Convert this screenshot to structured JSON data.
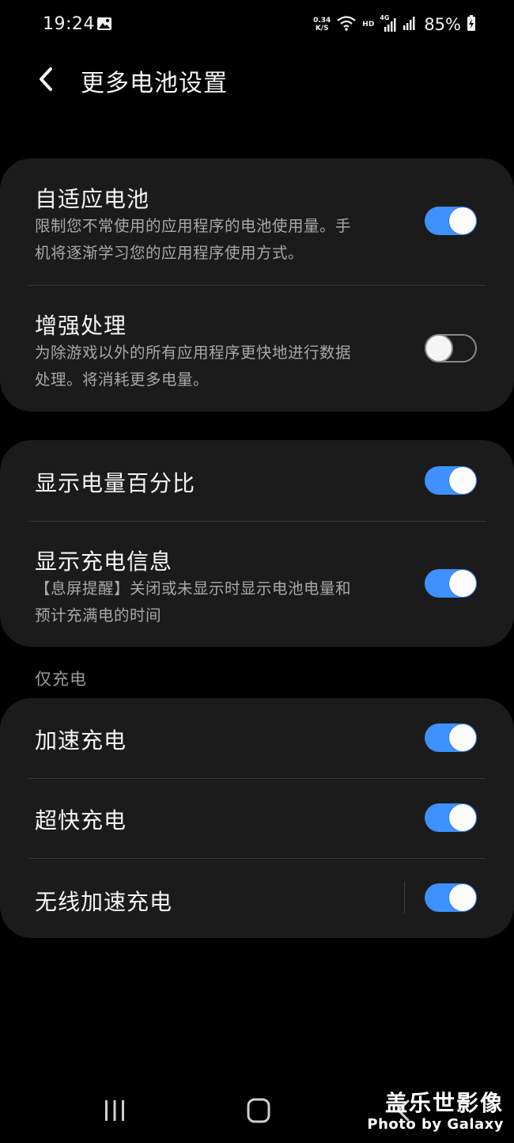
{
  "status_bar": {
    "time": "19:24",
    "net_speed_value": "0.34",
    "net_speed_unit": "K/S",
    "hd_label": "HD",
    "network_label": "4G",
    "battery_percent": "85%",
    "icons": [
      "image-notification-icon",
      "wifi-icon",
      "signal-icon",
      "battery-charging-icon"
    ]
  },
  "header": {
    "title": "更多电池设置"
  },
  "group1": {
    "items": [
      {
        "title": "自适应电池",
        "desc_line1": "限制您不常使用的应用程序的电池使用量。手",
        "desc_line2": "机将逐渐学习您的应用程序使用方式。",
        "enabled": true
      },
      {
        "title": "增强处理",
        "desc_line1": "为除游戏以外的所有应用程序更快地进行数据",
        "desc_line2": "处理。将消耗更多电量。",
        "enabled": false
      }
    ]
  },
  "group2": {
    "items": [
      {
        "title": "显示电量百分比",
        "enabled": true
      },
      {
        "title": "显示充电信息",
        "desc_line1": "【息屏提醒】关闭或未显示时显示电池电量和",
        "desc_line2": "预计充满电的时间",
        "enabled": true
      }
    ]
  },
  "charging_section": {
    "label": "仅充电",
    "items": [
      {
        "title": "加速充电",
        "enabled": true
      },
      {
        "title": "超快充电",
        "enabled": true
      },
      {
        "title": "无线加速充电",
        "enabled": true
      }
    ]
  },
  "watermark": {
    "cn": "盖乐世影像",
    "en": "Photo by Galaxy"
  },
  "colors": {
    "background": "#000000",
    "card": "#1b1b1b",
    "toggle_on": "#3e91ff",
    "secondary_text": "#a8a8a8"
  }
}
